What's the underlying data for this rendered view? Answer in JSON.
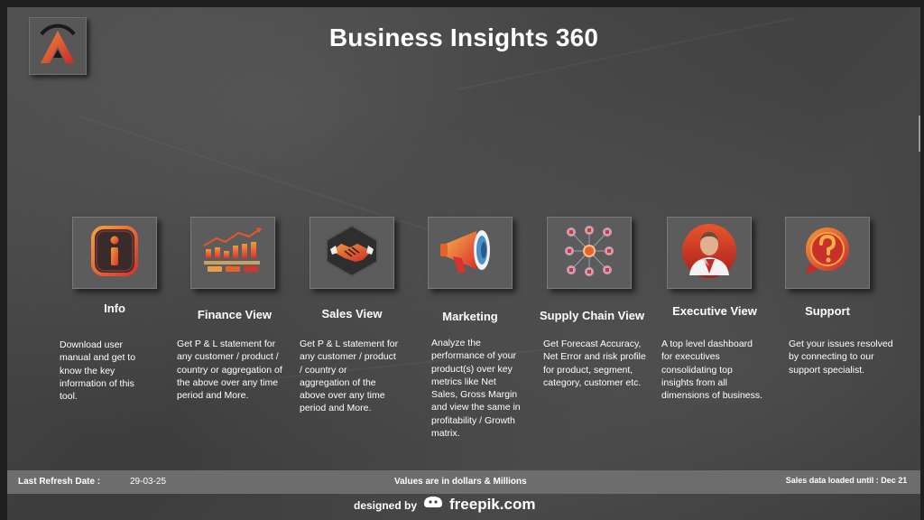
{
  "header": {
    "title": "Business Insights 360",
    "logo_icon": "a-logo-icon"
  },
  "tiles": [
    {
      "label": "Info",
      "icon": "info-icon",
      "description": " Download user manual and get to know the key information of this tool."
    },
    {
      "label": "Finance View",
      "icon": "finance-chart-icon",
      "description": "Get  P & L statement for any customer / product / country or aggregation of the above over any time period and More."
    },
    {
      "label": "Sales View",
      "icon": "handshake-icon",
      "description": "Get  P & L statement for any customer / product / country or aggregation of the above over any time period and More."
    },
    {
      "label": "Marketing",
      "icon": "megaphone-icon",
      "description": "Analyze the performance of your product(s) over key metrics like Net Sales, Gross Margin and view the same in profitability / Growth matrix."
    },
    {
      "label": "Supply Chain View",
      "icon": "supply-chain-network-icon",
      "description": "Get Forecast Accuracy, Net Error and risk profile for product, segment, category, customer etc."
    },
    {
      "label": "Executive View",
      "icon": "executive-icon",
      "description": " A top level dashboard for executives consolidating top insights from all dimensions of business."
    },
    {
      "label": "Support",
      "icon": "question-bubble-icon",
      "description": "Get your issues resolved by connecting to our support specialist."
    }
  ],
  "footer": {
    "refresh_label": "Last Refresh Date :",
    "refresh_date": "29-03-25",
    "values_note": "Values are in dollars & Millions",
    "sales_loaded": "Sales data loaded until : Dec 21"
  },
  "credit": {
    "designed_by": "designed by",
    "brand": "freepik.com"
  },
  "colors": {
    "background": "#424242",
    "tile": "#5c5c5c",
    "footer": "#6d6d6d",
    "accent_orange": "#e8632b",
    "accent_red": "#c8302a"
  }
}
